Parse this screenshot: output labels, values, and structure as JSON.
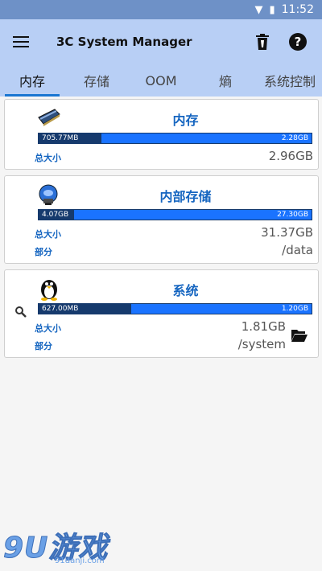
{
  "status": {
    "time": "11:52"
  },
  "appbar": {
    "title": "3C System Manager"
  },
  "tabs": [
    {
      "label": "内存"
    },
    {
      "label": "存储"
    },
    {
      "label": "OOM"
    },
    {
      "label": "熵"
    },
    {
      "label": "系统控制"
    }
  ],
  "cards": {
    "memory": {
      "title": "内存",
      "used": "705.77MB",
      "free": "2.28GB",
      "used_fraction": 0.23,
      "total_label": "总大小",
      "total": "2.96GB"
    },
    "storage": {
      "title": "内部存储",
      "used": "4.07GB",
      "free": "27.30GB",
      "used_fraction": 0.13,
      "total_label": "总大小",
      "total": "31.37GB",
      "part_label": "部分",
      "part": "/data"
    },
    "system": {
      "title": "系统",
      "used": "627.00MB",
      "free": "1.20GB",
      "used_fraction": 0.34,
      "total_label": "总大小",
      "total": "1.81GB",
      "part_label": "部分",
      "part": "/system"
    }
  },
  "watermark": {
    "main": "9U游戏",
    "sub": "91danji.com"
  }
}
